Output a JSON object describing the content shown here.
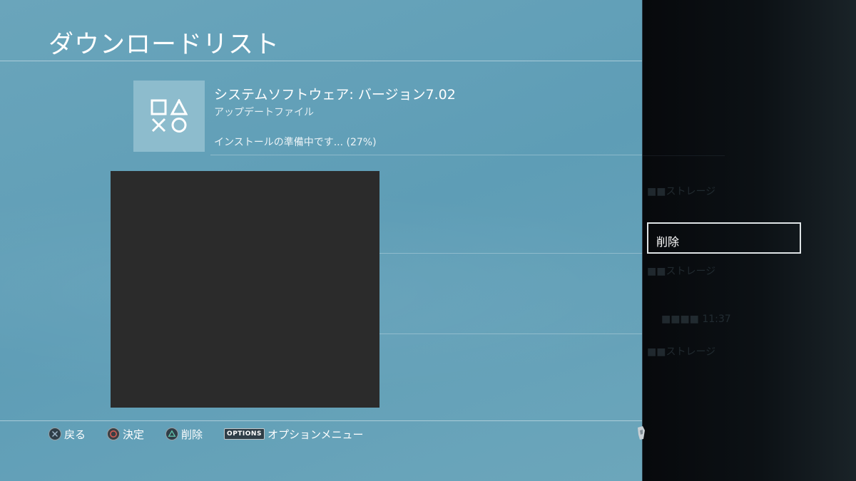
{
  "page": {
    "title": "ダウンロードリスト"
  },
  "download_item": {
    "title": "システムソフトウェア: バージョン7.02",
    "subtitle": "アップデートファイル",
    "status": "インストールの準備中です... (27%)",
    "progress_percent": 27,
    "thumbnail_icon": "playstation-shapes-icon"
  },
  "bottom_bar": {
    "back_label": "戻る",
    "confirm_label": "決定",
    "delete_label": "削除",
    "options_badge": "OPTIONS",
    "options_label": "オプションメニュー"
  },
  "side_menu": {
    "items": [
      {
        "label": "削除"
      }
    ]
  },
  "colors": {
    "background": "#65a1b8",
    "panel": "#0a0e12",
    "overlay": "#2b2b2b",
    "focus_border": "#dfe4e6"
  }
}
